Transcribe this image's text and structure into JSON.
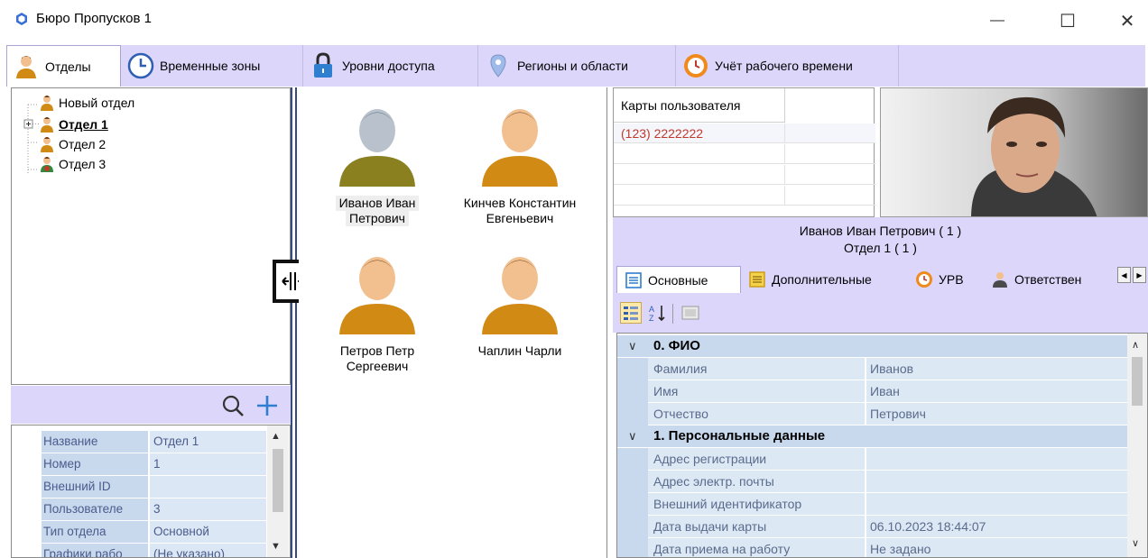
{
  "window": {
    "title": "Бюро Пропусков 1",
    "minimize": "—",
    "maximize": "☐",
    "close": "✕"
  },
  "tabs": [
    {
      "label": "Отделы",
      "icon": "person-icon"
    },
    {
      "label": "Временные зоны",
      "icon": "clock-icon"
    },
    {
      "label": "Уровни доступа",
      "icon": "lock-icon"
    },
    {
      "label": "Регионы и области",
      "icon": "map-pin-icon"
    },
    {
      "label": "Учёт рабочего времени",
      "icon": "alarm-clock-icon"
    }
  ],
  "tree": {
    "items": [
      {
        "label": "Новый отдел",
        "bold": false
      },
      {
        "label": "Отдел 1",
        "bold": true
      },
      {
        "label": "Отдел 2",
        "bold": false
      },
      {
        "label": "Отдел 3",
        "bold": false
      }
    ]
  },
  "left_props": {
    "rows": [
      {
        "k": "Название",
        "v": "Отдел 1"
      },
      {
        "k": "Номер",
        "v": "1"
      },
      {
        "k": "Внешний ID",
        "v": ""
      },
      {
        "k": "Пользователе",
        "v": "3"
      },
      {
        "k": "Тип отдела",
        "v": "Основной"
      },
      {
        "k": "Графики рабо",
        "v": "(Не указано)"
      }
    ]
  },
  "employees": [
    {
      "line1": "Иванов Иван",
      "line2": "Петрович",
      "selected": true
    },
    {
      "line1": "Кинчев Константин",
      "line2": "Евгеньевич",
      "selected": false
    },
    {
      "line1": "Петров Петр",
      "line2": "Сергеевич",
      "selected": false
    },
    {
      "line1": "Чаплин Чарли",
      "line2": "",
      "selected": false
    }
  ],
  "cards": {
    "header": "Карты пользователя",
    "rows": [
      "(123) 2222222",
      "",
      "",
      ""
    ],
    "card_color": "#c0392b"
  },
  "person": {
    "name_line": "Иванов Иван Петрович ( 1 )",
    "dept_line": "Отдел 1 ( 1 )"
  },
  "prop_tabs": [
    {
      "label": "Основные",
      "icon": "list-icon"
    },
    {
      "label": "Дополнительные",
      "icon": "notes-icon"
    },
    {
      "label": "УРВ",
      "icon": "alarm-clock-icon"
    },
    {
      "label": "Ответствен",
      "icon": "user-icon"
    }
  ],
  "prop_grid": {
    "cat0": "0. ФИО",
    "cat0_rows": [
      {
        "k": "Фамилия",
        "v": "Иванов"
      },
      {
        "k": "Имя",
        "v": "Иван"
      },
      {
        "k": "Отчество",
        "v": "Петрович"
      }
    ],
    "cat1": "1. Персональные данные",
    "cat1_rows": [
      {
        "k": "Адрес регистрации",
        "v": ""
      },
      {
        "k": "Адрес электр. почты",
        "v": ""
      },
      {
        "k": "Внешний идентификатор",
        "v": ""
      },
      {
        "k": "Дата выдачи карты",
        "v": "06.10.2023 18:44:07"
      },
      {
        "k": "Дата приема на работу",
        "v": "Не задано"
      }
    ]
  },
  "colors": {
    "accent": "#dcd6fb",
    "grid_key": "#c8d9ee",
    "grid_val": "#dde8f5",
    "splitter": "#3a4a7a",
    "search_blue": "#2f7fd1"
  }
}
